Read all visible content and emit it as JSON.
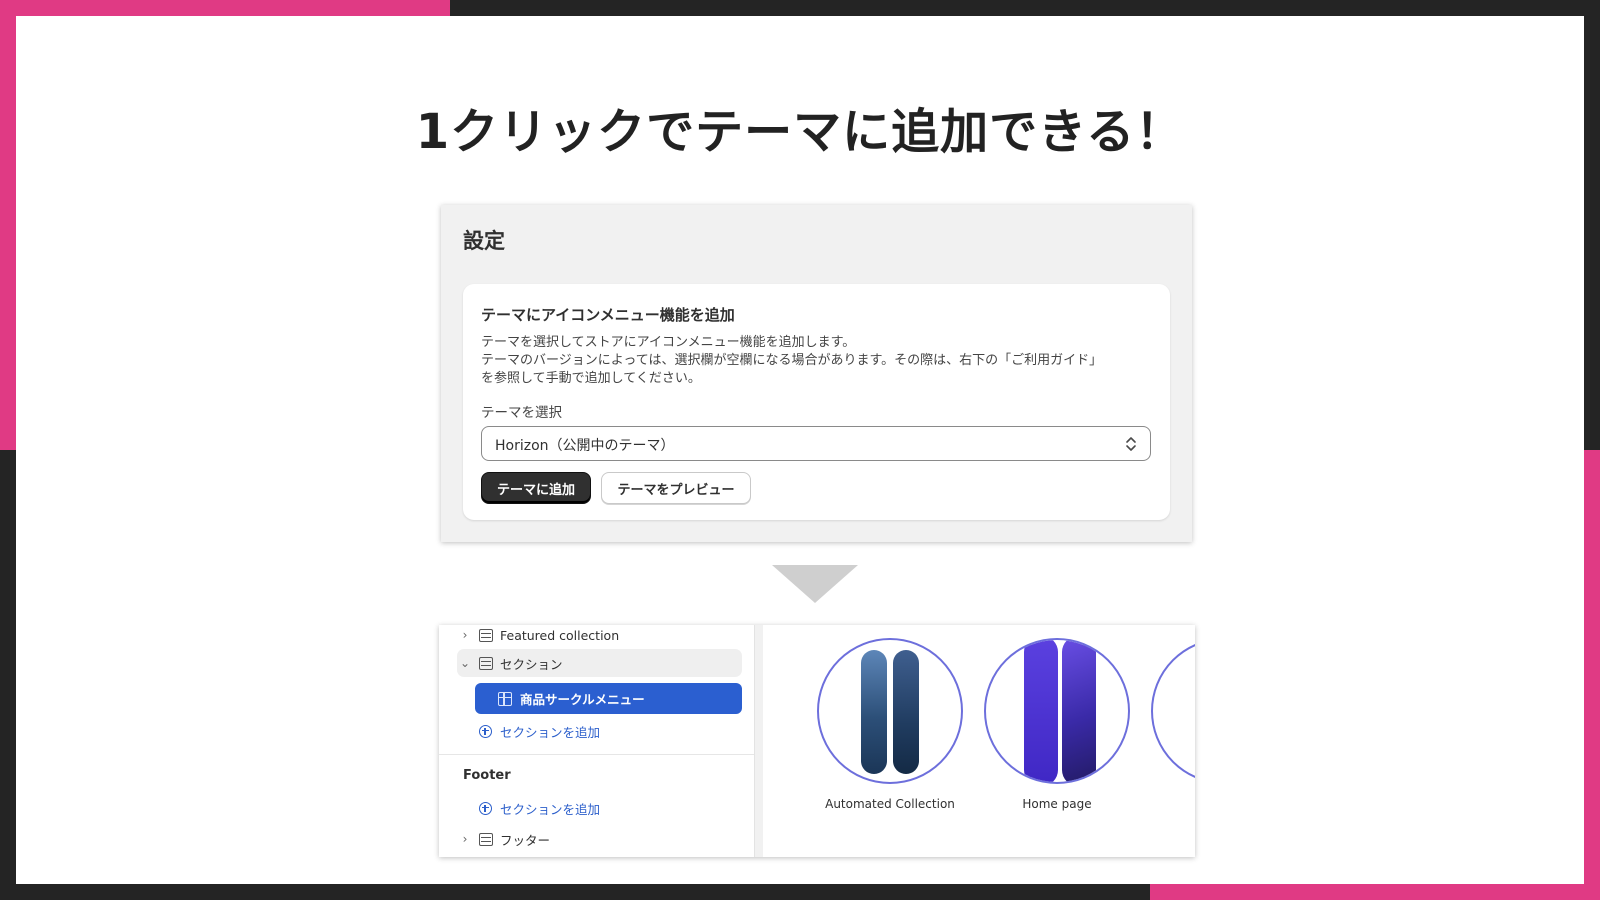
{
  "headline": "1クリックでテーマに追加できる！",
  "colors": {
    "accent": "#e03a84",
    "frame": "#242424",
    "primary_button": "#303030",
    "selected_item": "#2b5fd0",
    "link_blue": "#2c5fcb",
    "circle_border": "#6d6fdc"
  },
  "settings": {
    "title": "設定",
    "card": {
      "heading": "テーマにアイコンメニュー機能を追加",
      "description_lines": [
        "テーマを選択してストアにアイコンメニュー機能を追加します。",
        "テーマのバージョンによっては、選択欄が空欄になる場合があります。その際は、右下の「ご利用ガイド」",
        "を参照して手動で追加してください。"
      ],
      "select_label": "テーマを選択",
      "select_value": "Horizon（公開中のテーマ）",
      "add_button": "テーマに追加",
      "preview_button": "テーマをプレビュー"
    }
  },
  "editor": {
    "tree": {
      "featured_collection": "Featured collection",
      "section_group": "セクション",
      "selected_item": "商品サークルメニュー",
      "add_section": "セクションを追加",
      "footer_heading": "Footer",
      "footer_add_section": "セクションを追加",
      "footer_item": "フッター"
    },
    "preview": {
      "items": [
        {
          "label": "Automated Collection"
        },
        {
          "label": "Home page"
        },
        {
          "label": ""
        }
      ]
    }
  }
}
